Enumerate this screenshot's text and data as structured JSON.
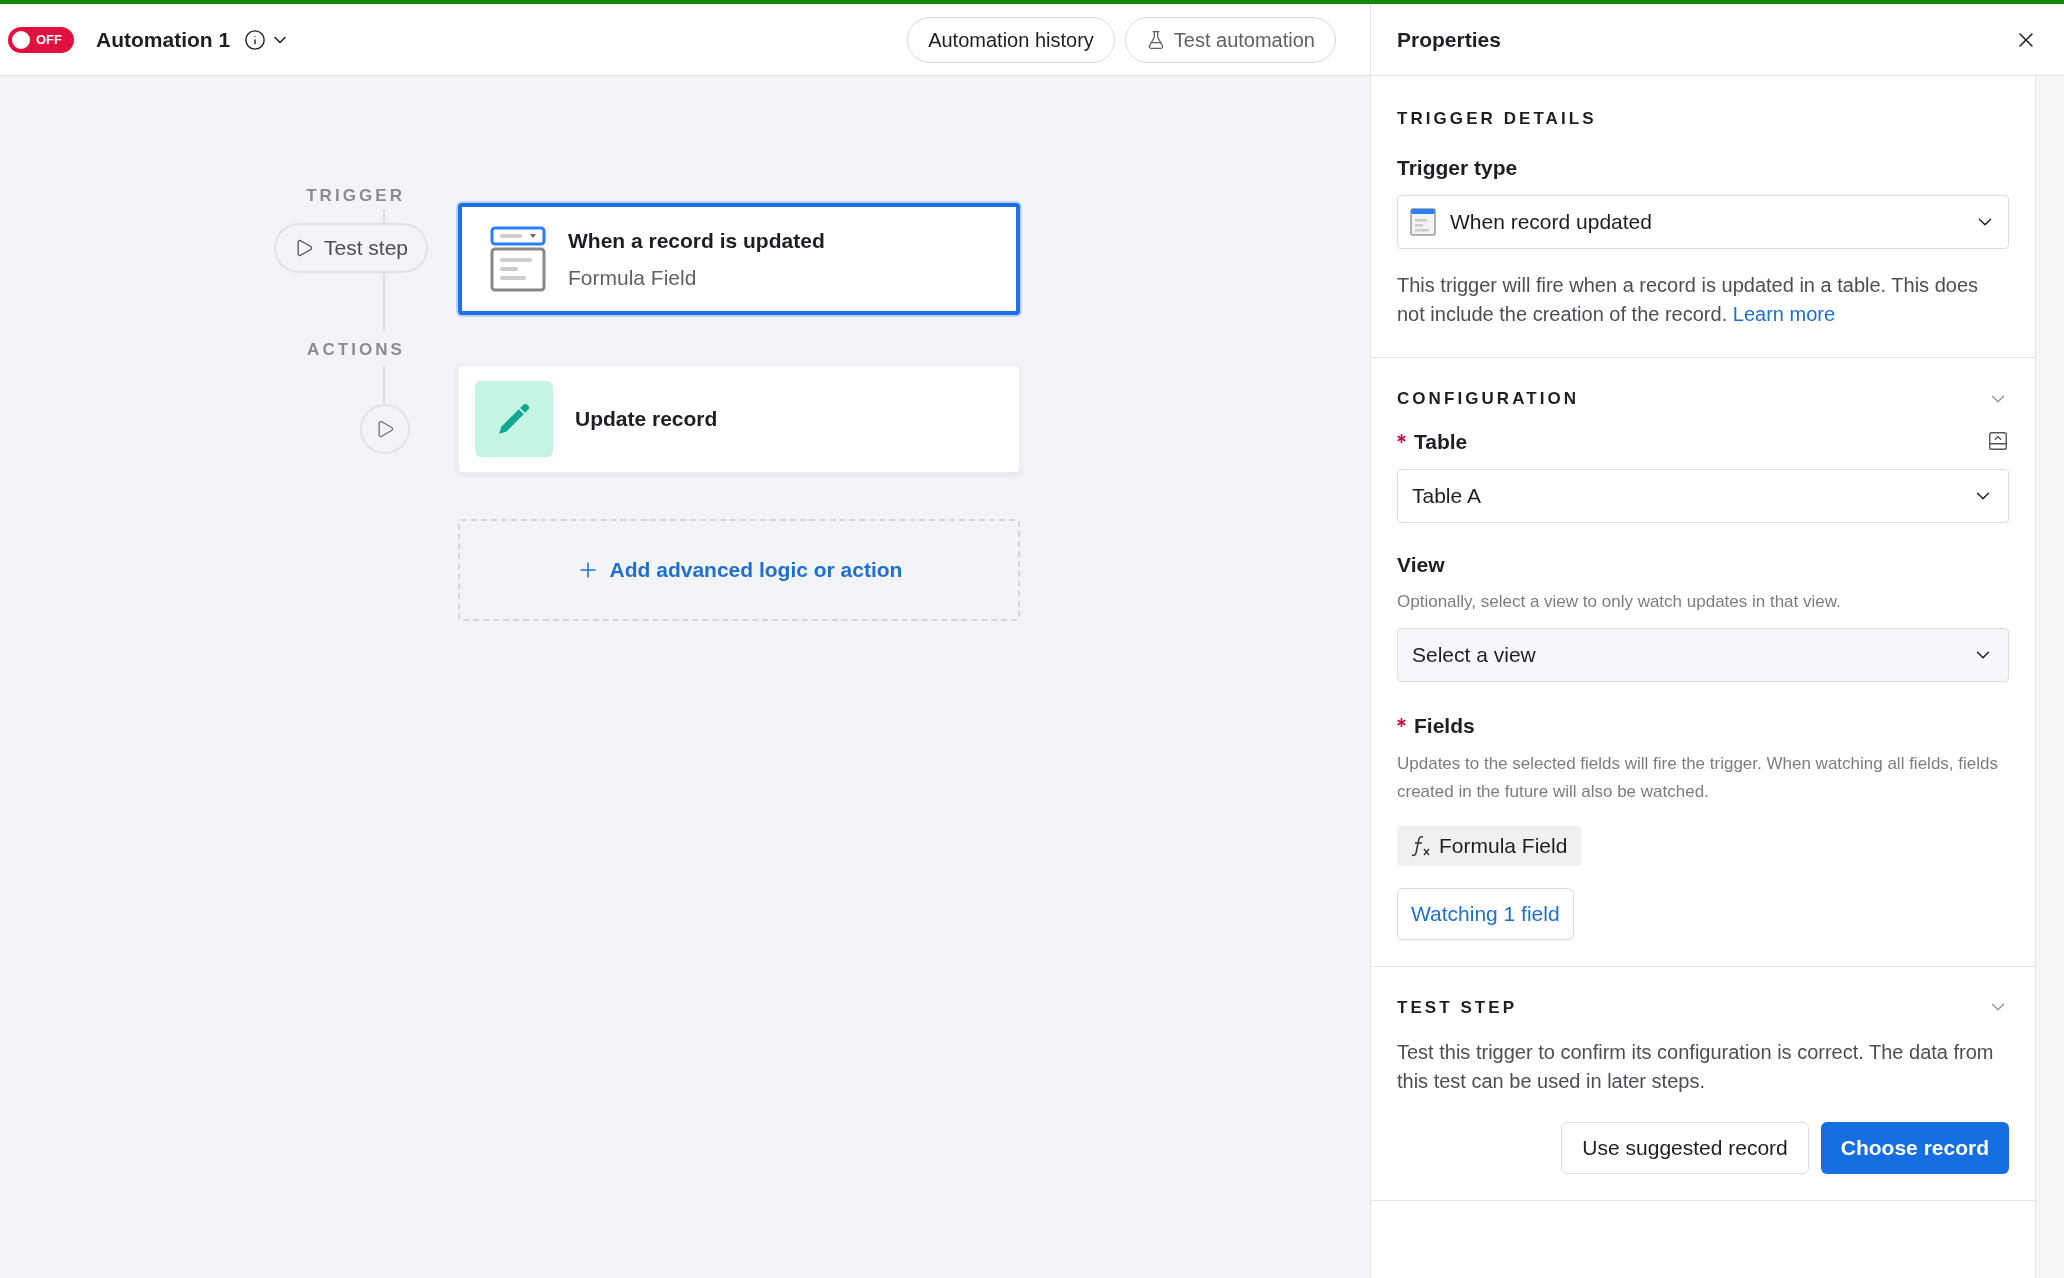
{
  "header": {
    "toggle": {
      "on": false,
      "label": "OFF"
    },
    "title": "Automation 1",
    "buttons": [
      {
        "label": "Automation history",
        "kind": "plain"
      },
      {
        "label": "Test automation",
        "kind": "test"
      }
    ]
  },
  "canvas": {
    "trigger_label": "TRIGGER",
    "test_step": "Test step",
    "actions_label": "ACTIONS",
    "steps": [
      {
        "kind": "trigger",
        "title": "When a record is updated",
        "subtitle": "Formula Field",
        "selected": true
      },
      {
        "kind": "action",
        "title": "Update record",
        "selected": false
      }
    ],
    "add": "Add advanced logic or action"
  },
  "properties": {
    "title": "Properties",
    "trigger_details": {
      "heading": "TRIGGER DETAILS",
      "label": "Trigger type",
      "value": "When record updated",
      "description": "This trigger will fire when a record is updated in a table. This does not include the creation of the record.",
      "link": "Learn more"
    },
    "configuration": {
      "heading": "CONFIGURATION",
      "expanded": true,
      "table": {
        "label": "Table",
        "required": true,
        "value": "Table A"
      },
      "view": {
        "label": "View",
        "required": false,
        "hint": "Optionally, select a view to only watch updates in that view.",
        "placeholder": "Select a view"
      },
      "fields": {
        "label": "Fields",
        "required": true,
        "hint": "Updates to the selected fields will fire the trigger. When watching all fields, fields created in the future will also be watched.",
        "chips": [
          "Formula Field"
        ],
        "button": "Watching 1 field"
      }
    },
    "test_step": {
      "heading": "TEST STEP",
      "expanded": true,
      "description": "Test this trigger to confirm its configuration is correct. The data from this test can be used in later steps.",
      "buttons": [
        {
          "label": "Use suggested record",
          "kind": "secondary"
        },
        {
          "label": "Choose record",
          "kind": "primary"
        }
      ]
    }
  }
}
